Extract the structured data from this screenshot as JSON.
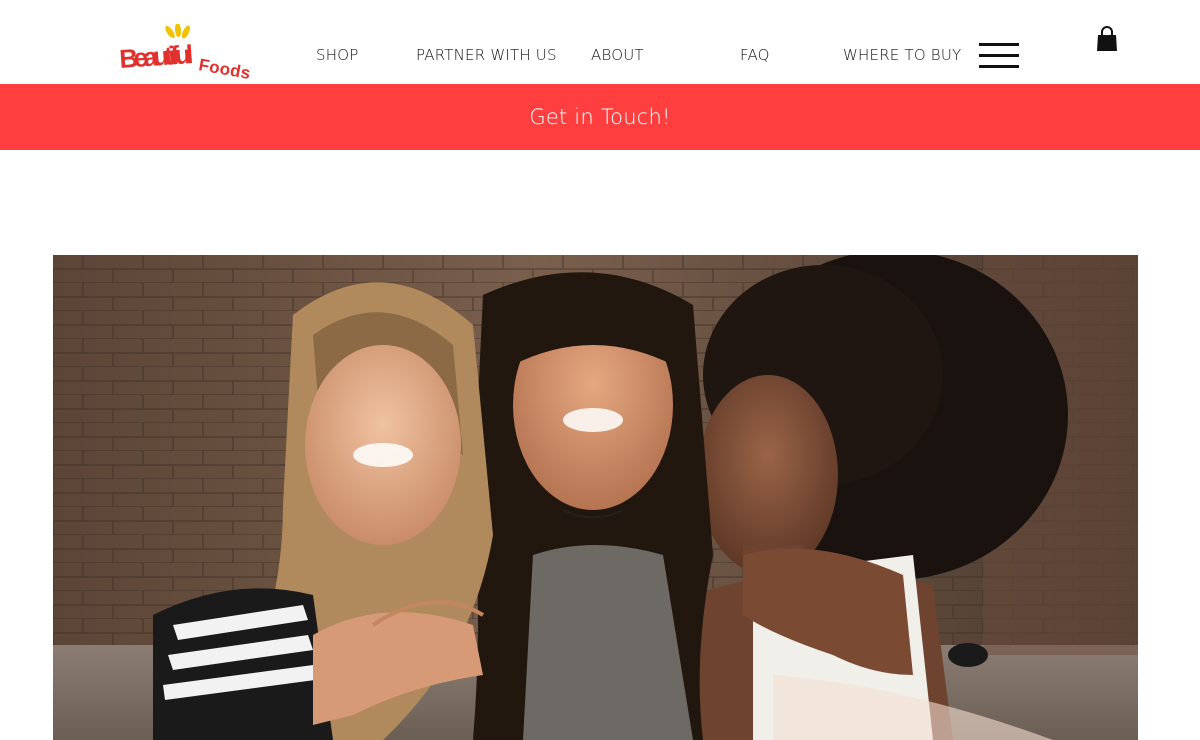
{
  "brand": {
    "logo_text": "Beautiful Foods",
    "logo_color": "#e0312c",
    "logo_accent": "#f2c200"
  },
  "nav": {
    "items": [
      {
        "label": "SHOP"
      },
      {
        "label": "PARTNER WITH US"
      },
      {
        "label": "ABOUT"
      },
      {
        "label": "FAQ"
      },
      {
        "label": "WHERE TO BUY"
      }
    ],
    "menu_icon": "hamburger-menu-icon",
    "cart_icon": "shopping-bag-icon"
  },
  "banner": {
    "text": "Get in Touch!",
    "background": "#ff3f3f"
  },
  "hero": {
    "image_subject": "three smiling young women posing together in front of a brick wall"
  }
}
